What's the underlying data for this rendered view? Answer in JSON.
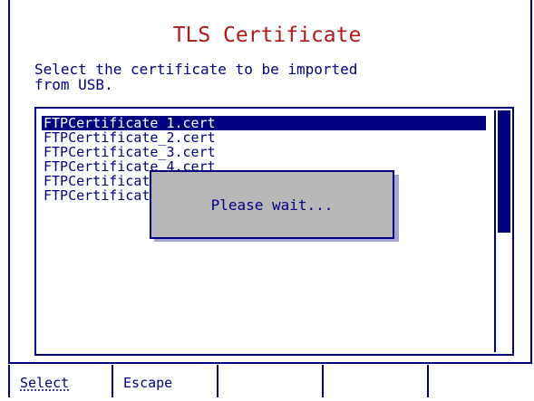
{
  "window": {
    "title": "TLS Certificate",
    "instruction": "Select the certificate to be imported\nfrom USB."
  },
  "certificate_list": {
    "items": [
      {
        "label": "FTPCertificate_1.cert",
        "selected": true
      },
      {
        "label": "FTPCertificate_2.cert",
        "selected": false
      },
      {
        "label": "FTPCertificate_3.cert",
        "selected": false
      },
      {
        "label": "FTPCertificate_4.cert",
        "selected": false
      },
      {
        "label": "FTPCertificate_5.cert",
        "selected": false
      },
      {
        "label": "FTPCertificate_6.cert",
        "selected": false
      }
    ]
  },
  "dialog": {
    "message": "Please wait..."
  },
  "softkeys": {
    "select_label": "Select",
    "escape_label": "Escape"
  },
  "colors": {
    "accent": "#000080",
    "title": "#b01818",
    "dialog_bg": "#b8b8b8"
  }
}
